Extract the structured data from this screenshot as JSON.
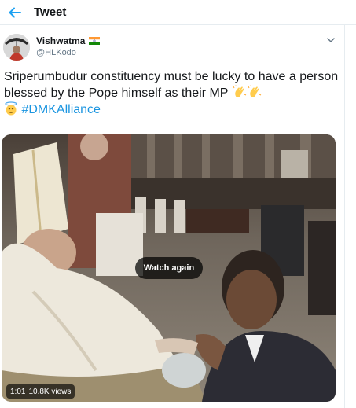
{
  "header": {
    "title": "Tweet",
    "back_icon": "arrow-left-icon",
    "accent_color": "#1da1f2"
  },
  "tweet": {
    "author": {
      "name": "Vishwatma",
      "handle": "@HLKodo",
      "flag_icon": "india-flag-icon"
    },
    "text_parts": {
      "line": "Sriperumbudur constituency must be lucky to have a person blessed by the Pope himself as their MP",
      "hashtag": "#DMKAlliance"
    },
    "emojis": [
      "clapping-hands-icon",
      "clapping-hands-icon",
      "smiling-face-with-halo-icon"
    ],
    "hashtag_color": "#1b95e0",
    "menu_icon": "chevron-down-icon"
  },
  "video": {
    "watch_again_label": "Watch again",
    "duration": "1:01",
    "views": "10.8K views"
  }
}
